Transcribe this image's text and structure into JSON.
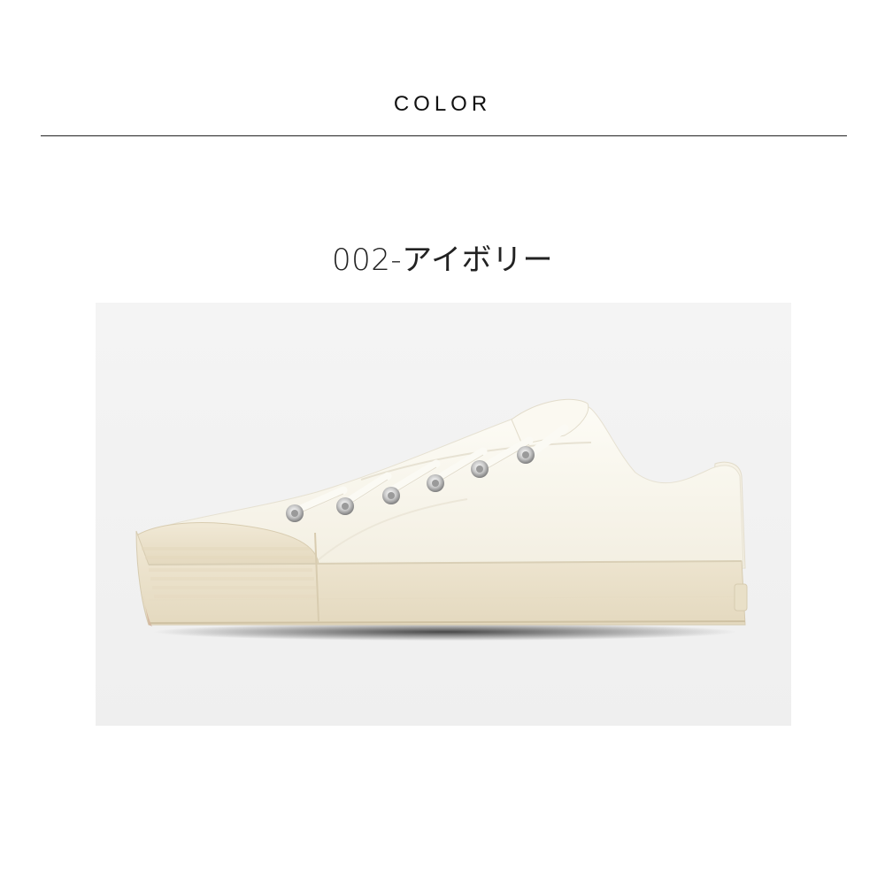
{
  "section": {
    "title": "COLOR"
  },
  "product": {
    "color_label": "002-アイボリー",
    "image": {
      "subject": "shoe-photo",
      "colors": {
        "canvas": "#fcfaf2",
        "sole": "#eee5cf",
        "background": "#f2f2f2"
      }
    }
  }
}
